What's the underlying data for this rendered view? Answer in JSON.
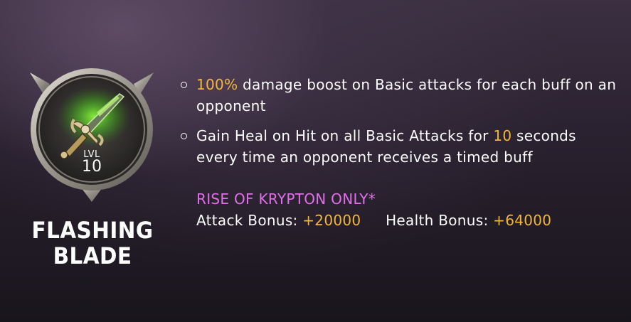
{
  "ability": {
    "name": "FLASHING BLADE",
    "level_label": "LVL",
    "level": "10",
    "icon": "sword-icon"
  },
  "bullets": [
    {
      "highlight": "100%",
      "text_after": " damage boost on Basic attacks for each buff on an opponent"
    },
    {
      "text_before": "Gain Heal on Hit on all Basic Attacks for ",
      "highlight": "10",
      "text_after": " seconds every time an opponent receives a timed buff"
    }
  ],
  "bonus_section": {
    "title": "RISE OF KRYPTON ONLY*",
    "attack_label": "Attack Bonus: ",
    "attack_value": "+20000",
    "health_label": "Health Bonus: ",
    "health_value": "+64000"
  },
  "colors": {
    "highlight": "#f4b63a",
    "section_title": "#e070e8",
    "text": "#ffffff",
    "sword_glow": "#6cff2a"
  }
}
